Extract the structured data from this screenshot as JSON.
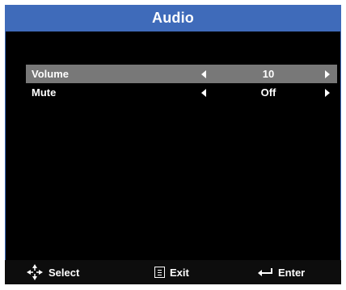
{
  "header": {
    "title": "Audio"
  },
  "menu": {
    "items": [
      {
        "label": "Volume",
        "value": "10",
        "selected": true
      },
      {
        "label": "Mute",
        "value": "Off",
        "selected": false
      }
    ]
  },
  "footer": {
    "select_label": "Select",
    "exit_label": "Exit",
    "enter_label": "Enter"
  },
  "colors": {
    "title_bar": "#3f6bba",
    "selected_row": "#787878",
    "background": "#000000"
  }
}
